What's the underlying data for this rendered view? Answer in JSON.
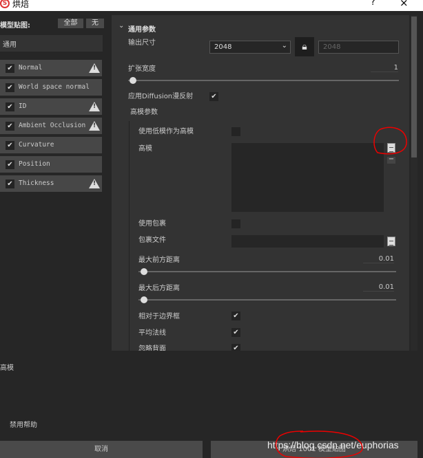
{
  "window": {
    "title": "烘焙",
    "help": "?",
    "close": "×"
  },
  "left": {
    "heading": "模型贴图:",
    "all_label": "全部",
    "none_label": "无",
    "group": "通用",
    "items": [
      {
        "label": "Normal",
        "checked": true,
        "warning": true
      },
      {
        "label": "World space normal",
        "checked": true,
        "warning": false
      },
      {
        "label": "ID",
        "checked": true,
        "warning": true
      },
      {
        "label": "Ambient Occlusion",
        "checked": true,
        "warning": true
      },
      {
        "label": "Curvature",
        "checked": true,
        "warning": false
      },
      {
        "label": "Position",
        "checked": true,
        "warning": false
      },
      {
        "label": "Thickness",
        "checked": true,
        "warning": true
      }
    ]
  },
  "params": {
    "section": "通用参数",
    "output_size_label": "输出尺寸",
    "output_size": "2048",
    "output_size_locked": "2048",
    "dilation_label": "扩张宽度",
    "dilation": "1",
    "diffusion_label": "应用Diffusion漫反射",
    "highpoly_section": "高模参数",
    "use_low_as_high": "使用低模作为高模",
    "highpoly_label": "高模",
    "use_cage": "使用包裹",
    "cage_file": "包裹文件",
    "max_front_label": "最大前方距离",
    "max_front": "0.01",
    "max_rear_label": "最大后方距离",
    "max_rear": "0.01",
    "relative_bbox": "相对于边界框",
    "average_normals": "平均法线",
    "ignore_backface": "忽略背面"
  },
  "help": {
    "title": "高模",
    "disable_help": "禁用帮助"
  },
  "footer": {
    "cancel": "取消",
    "bake": "烘焙 1001 模型贴图",
    "watermark": "https://blog.csdn.net/euphorias"
  },
  "check": "✔"
}
